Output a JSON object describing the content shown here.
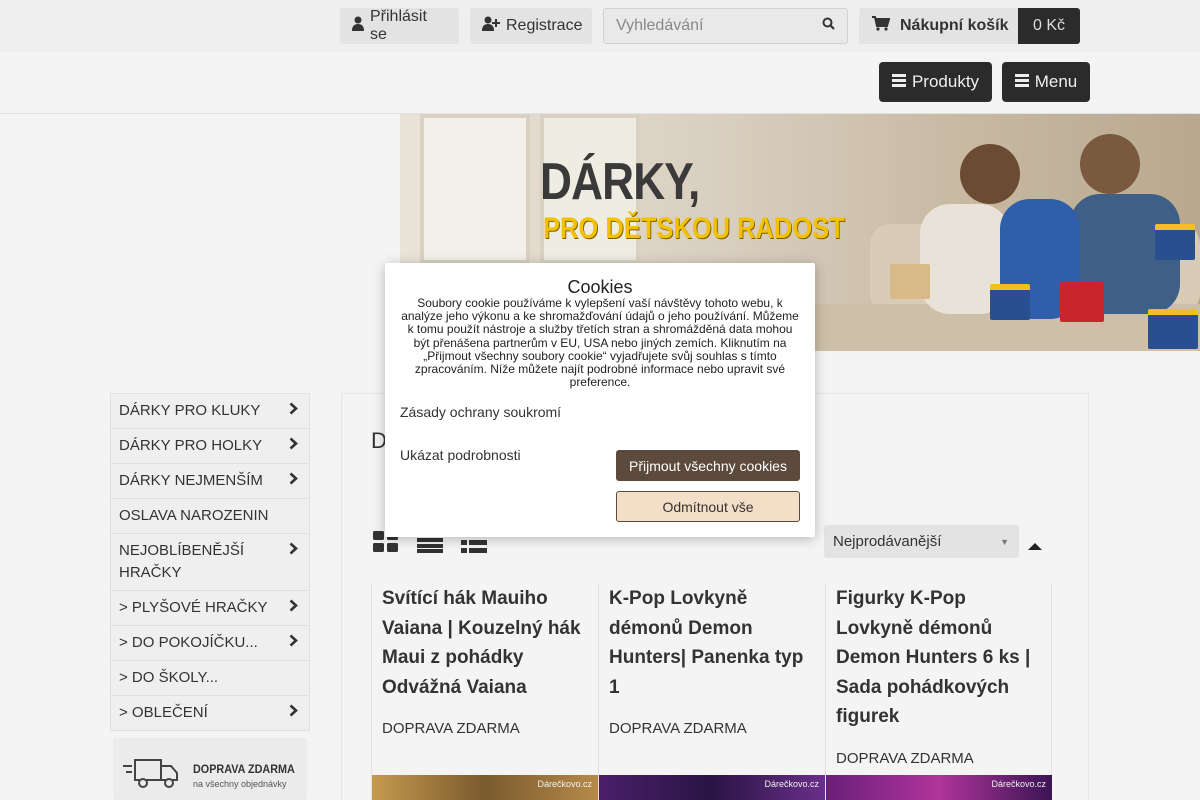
{
  "topbar": {
    "login_label": "Přihlásit se",
    "register_label": "Registrace",
    "search_placeholder": "Vyhledávání",
    "cart_label": "Nákupní košík",
    "cart_total": "0 Kč"
  },
  "nav": {
    "products_label": "Produkty",
    "menu_label": "Menu"
  },
  "banner": {
    "headline": "DÁRKY,",
    "subheadline": "PRO DĚTSKOU RADOST"
  },
  "sidebar": {
    "items": [
      {
        "label": "DÁRKY PRO KLUKY",
        "has_children": true
      },
      {
        "label": "DÁRKY PRO HOLKY",
        "has_children": true
      },
      {
        "label": "DÁRKY NEJMENŠÍM",
        "has_children": true
      },
      {
        "label": "OSLAVA NAROZENIN",
        "has_children": false
      },
      {
        "label": "NEJOBLÍBENĚJŠÍ HRAČKY",
        "has_children": true
      },
      {
        "label": "> PLYŠOVÉ HRAČKY",
        "has_children": true
      },
      {
        "label": "> DO POKOJÍČKU...",
        "has_children": true
      },
      {
        "label": "> DO ŠKOLY...",
        "has_children": false
      },
      {
        "label": "> OBLEČENÍ",
        "has_children": true
      }
    ],
    "promo_title": "DOPRAVA ZDARMA",
    "promo_subtitle": "na všechny objednávky"
  },
  "main": {
    "heading_initial": "D",
    "sort_selected": "Nejprodávanější",
    "products": [
      {
        "name": "Svítící hák Mauiho Vaiana | Kouzelný hák Maui z pohádky Odvážná Vaiana",
        "shipping": "DOPRAVA ZDARMA",
        "watermark": "Dárečkovo.cz",
        "thumb_color": "#8a6a3a"
      },
      {
        "name": "K-Pop Lovkyně démonů Demon Hunters| Panenka typ 1",
        "shipping": "DOPRAVA ZDARMA",
        "watermark": "Dárečkovo.cz",
        "thumb_color": "#3a1f5a"
      },
      {
        "name": "Figurky K-Pop Lovkyně démonů Demon Hunters 6 ks | Sada pohádkových figurek",
        "shipping": "DOPRAVA ZDARMA",
        "watermark": "Dárečkovo.cz",
        "thumb_color": "#5a1f6a"
      }
    ]
  },
  "cookie": {
    "title": "Cookies",
    "text": "Soubory cookie používáme k vylepšení vaší návštěvy tohoto webu, k analýze jeho výkonu a ke shromažďování údajů o jeho používání. Můžeme k tomu použít nástroje a služby třetích stran a shromážděná data mohou být přenášena partnerům v EU, USA nebo jiných zemích. Kliknutím na „Přijmout všechny soubory cookie“ vyjadřujete svůj souhlas s tímto zpracováním. Níže můžete najít podrobné informace nebo upravit své preference.",
    "privacy_link": "Zásady ochrany soukromí",
    "details_link": "Ukázat podrobnosti",
    "accept_label": "Přijmout všechny cookies",
    "reject_label": "Odmítnout vše"
  },
  "colors": {
    "accent_dark": "#2b2b2b",
    "cookie_accept": "#5c4a3c",
    "cookie_reject_bg": "#f5dec8"
  }
}
